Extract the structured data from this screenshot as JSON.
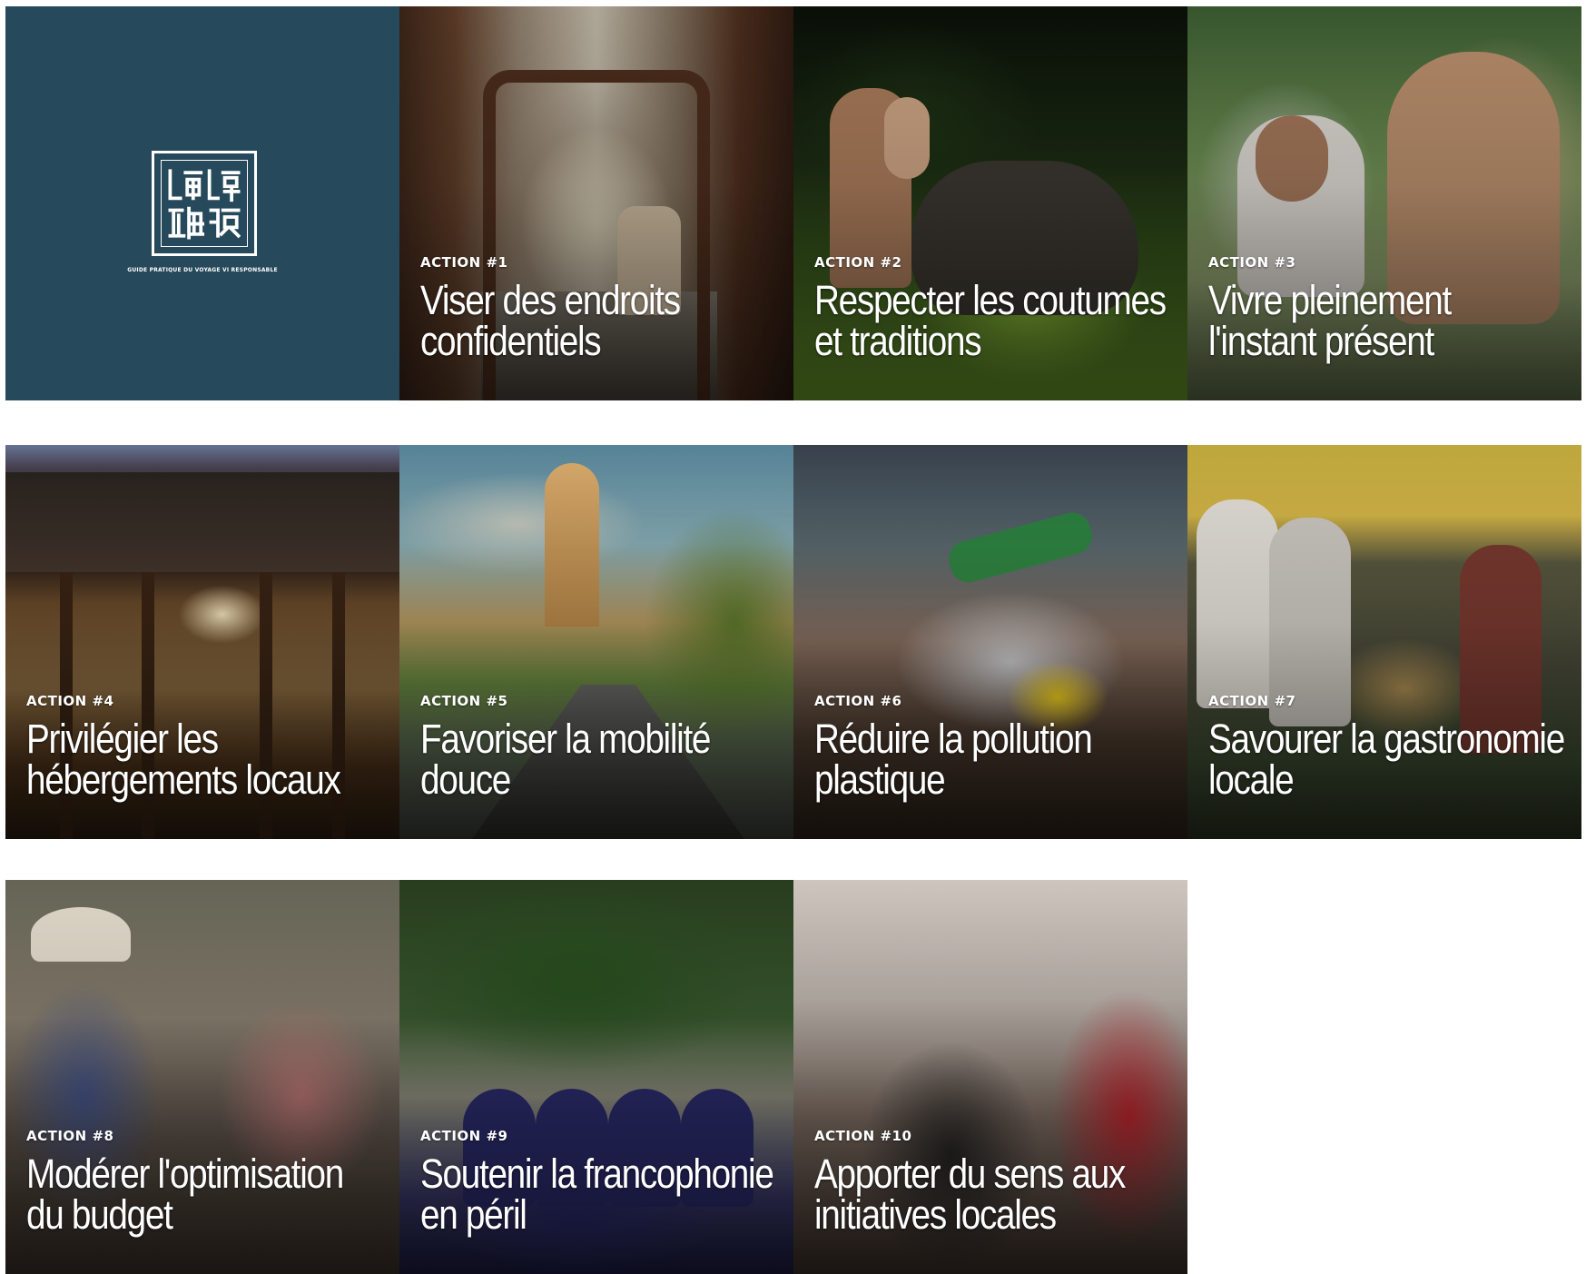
{
  "brand": {
    "tagline": "GUIDE PRATIQUE DU VOYAGE VI RESPONSABLE",
    "background_color": "#26495b",
    "stamp_icon": "seal-logo-icon"
  },
  "actions": [
    {
      "kicker": "ACTION #1",
      "title": "Viser des endroits confidentiels"
    },
    {
      "kicker": "ACTION #2",
      "title": "Respecter les coutumes et traditions"
    },
    {
      "kicker": "ACTION #3",
      "title": "Vivre pleinement l'instant présent"
    },
    {
      "kicker": "ACTION #4",
      "title": "Privilégier les hébergements locaux"
    },
    {
      "kicker": "ACTION #5",
      "title": "Favoriser la mobilité douce"
    },
    {
      "kicker": "ACTION #6",
      "title": "Réduire la pollution plastique"
    },
    {
      "kicker": "ACTION #7",
      "title": "Savourer la gastronomie locale"
    },
    {
      "kicker": "ACTION #8",
      "title": "Modérer l'optimisation du budget"
    },
    {
      "kicker": "ACTION #9",
      "title": "Soutenir la francophonie en péril"
    },
    {
      "kicker": "ACTION #10",
      "title": "Apporter du sens aux initiatives locales"
    }
  ]
}
